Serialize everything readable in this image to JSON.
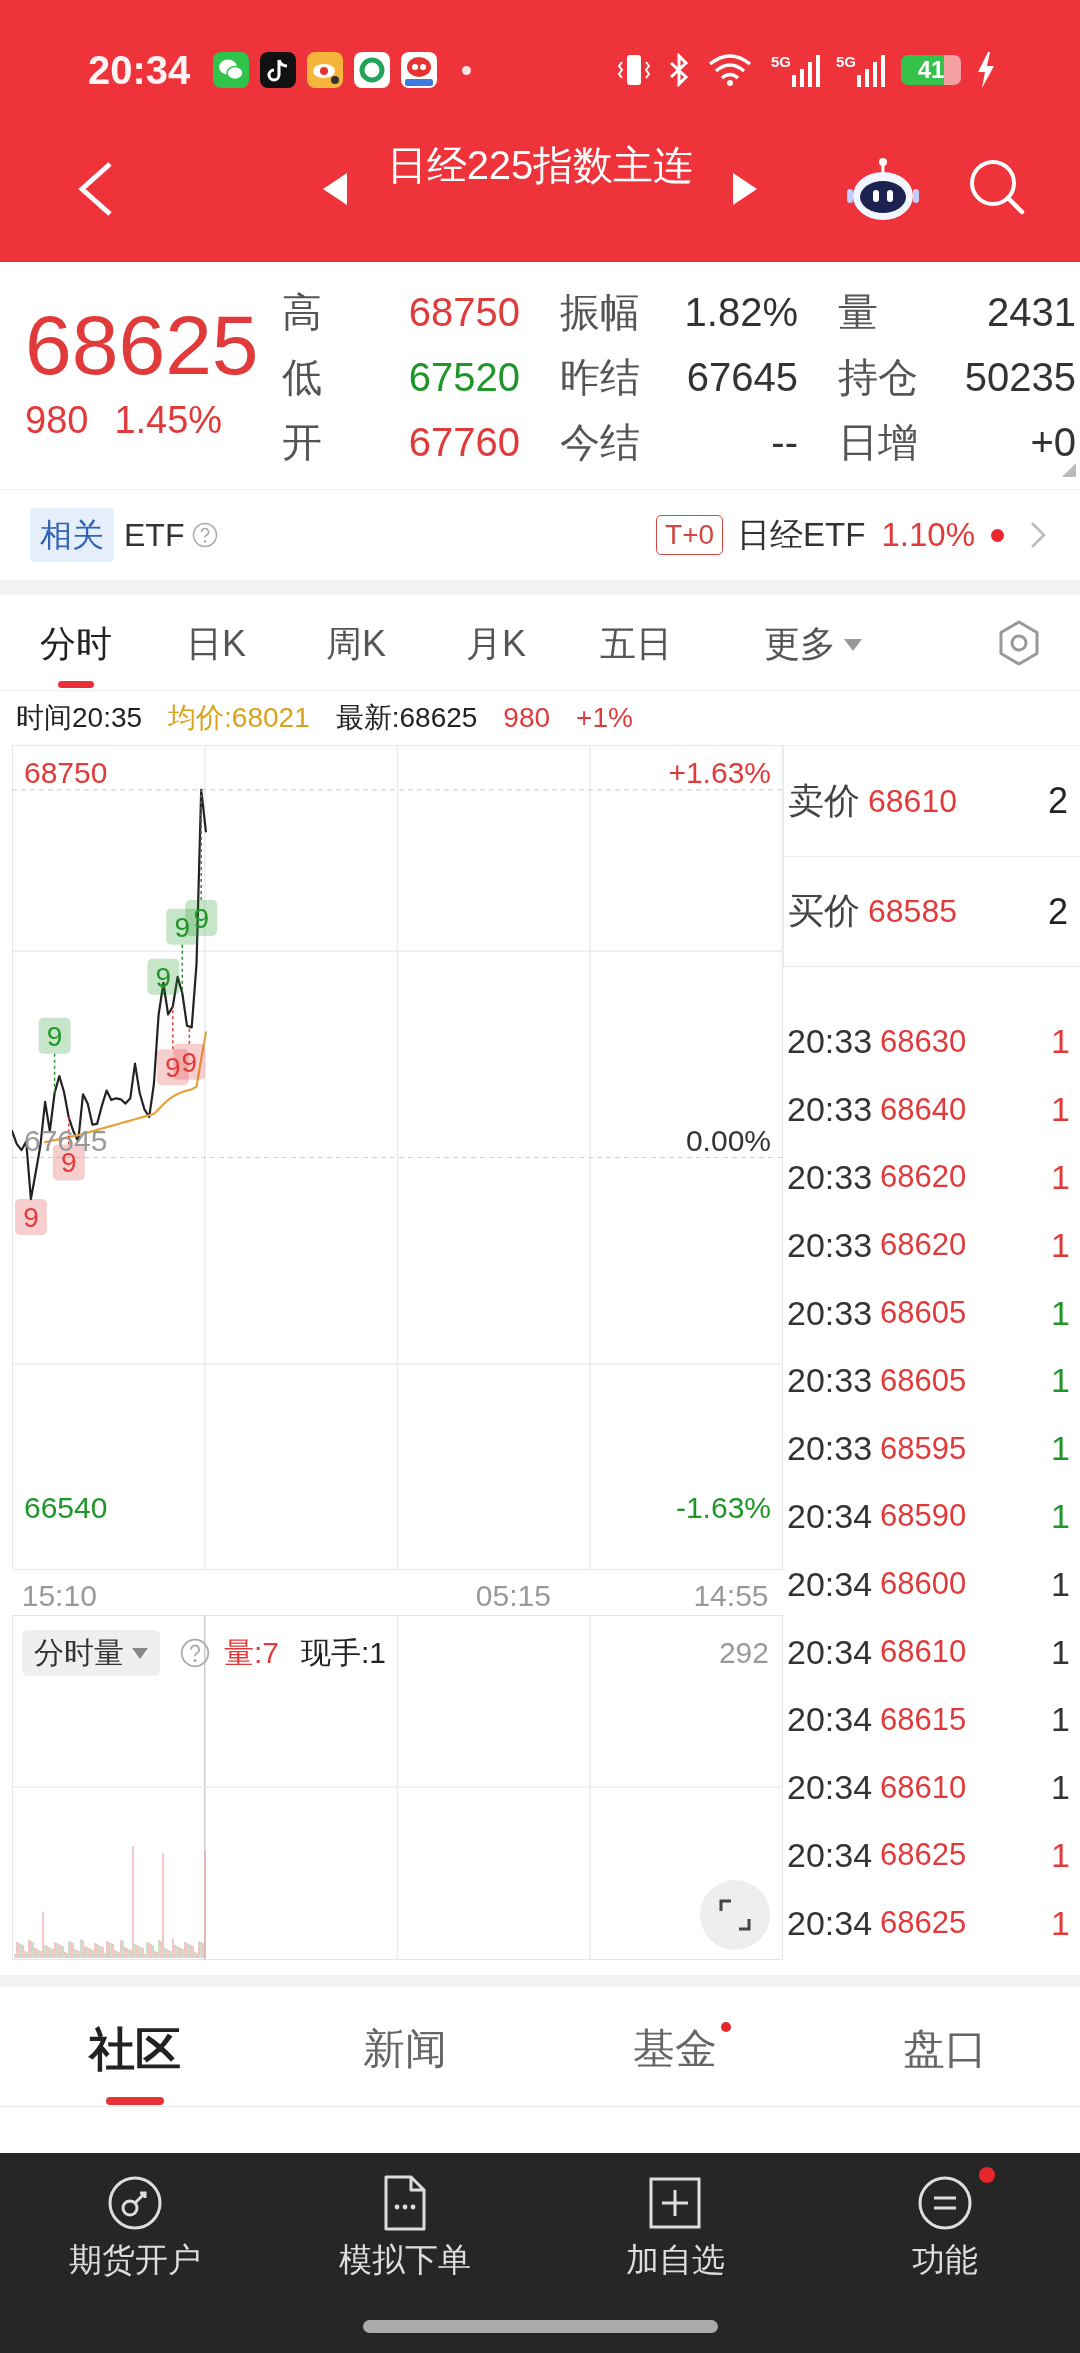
{
  "status_bar": {
    "time": "20:34",
    "network": [
      "5G",
      "5G"
    ],
    "battery": "41"
  },
  "header": {
    "title": "日经225指数主连"
  },
  "quote": {
    "price": "68625",
    "change": "980",
    "change_percent": "1.45%",
    "stats": [
      {
        "label": "高",
        "value": "68750",
        "color": "#e03a3a"
      },
      {
        "label": "振幅",
        "value": "1.82%",
        "color": "#333333"
      },
      {
        "label": "量",
        "value": "2431",
        "color": "#333333"
      },
      {
        "label": "低",
        "value": "67520",
        "color": "#1e9628"
      },
      {
        "label": "昨结",
        "value": "67645",
        "color": "#333333"
      },
      {
        "label": "持仓",
        "value": "50235",
        "color": "#333333"
      },
      {
        "label": "开",
        "value": "67760",
        "color": "#e03a3a"
      },
      {
        "label": "今结",
        "value": "--",
        "color": "#333333"
      },
      {
        "label": "日增",
        "value": "+0",
        "color": "#333333"
      }
    ]
  },
  "related": {
    "tag": "相关",
    "label": "ETF",
    "badge": "T+0",
    "fund": "日经ETF",
    "change": "1.10%"
  },
  "chart_tabs": [
    {
      "label": "分时",
      "selected": true,
      "kind": "tab"
    },
    {
      "label": "日K",
      "selected": false,
      "kind": "tab"
    },
    {
      "label": "周K",
      "selected": false,
      "kind": "tab"
    },
    {
      "label": "月K",
      "selected": false,
      "kind": "tab"
    },
    {
      "label": "五日",
      "selected": false,
      "kind": "tab"
    },
    {
      "label": "更多",
      "selected": false,
      "kind": "menu"
    }
  ],
  "info_line": [
    {
      "text": "时间20:35",
      "color": "#222222"
    },
    {
      "text": "均价:68021",
      "color": "#d9a21b"
    },
    {
      "text": "最新:68625",
      "color": "#222222"
    },
    {
      "text": "980",
      "color": "#e03a3a"
    },
    {
      "text": "+1%",
      "color": "#e03a3a"
    }
  ],
  "chart": {
    "change_labels": [
      {
        "text": "+1.63%",
        "color": "#e03a3a"
      },
      {
        "text": "0.00%",
        "color": "#333333"
      },
      {
        "text": "-1.63%",
        "color": "#1e9628"
      }
    ],
    "markers": [
      {
        "text": "9",
        "color": "#e03a3a"
      },
      {
        "text": "9",
        "color": "#1e9628"
      },
      {
        "text": "9",
        "color": "#e03a3a"
      },
      {
        "text": "9",
        "color": "#1e9628"
      },
      {
        "text": "9",
        "color": "#e03a3a"
      },
      {
        "text": "9",
        "color": "#1e9628"
      },
      {
        "text": "9",
        "color": "#e03a3a"
      },
      {
        "text": "9",
        "color": "#1e9628"
      }
    ],
    "chart_data": {
      "type": "line",
      "categories": [
        null,
        null,
        null,
        null,
        null,
        null,
        null,
        null,
        null,
        null,
        "15:10",
        null,
        null,
        null,
        null,
        null,
        null,
        null,
        null,
        null,
        null,
        null,
        null,
        null,
        null,
        null,
        null,
        null,
        null,
        null,
        null,
        null,
        null,
        null,
        null,
        null,
        null,
        null,
        null,
        null,
        null,
        null,
        null,
        null,
        null,
        null,
        null,
        null,
        null,
        null,
        null,
        null,
        null,
        null,
        null,
        null,
        null,
        null,
        null,
        null,
        null,
        null,
        null,
        null,
        null,
        null,
        null,
        null,
        null,
        null,
        null,
        null,
        null,
        null,
        null,
        null,
        null,
        null,
        null,
        null,
        null,
        null,
        null,
        null,
        null,
        null,
        null,
        null,
        null,
        null,
        null,
        null,
        null,
        null,
        null,
        null,
        null,
        null,
        null,
        null,
        null,
        null,
        null,
        null,
        null,
        null,
        "05:15",
        null,
        null,
        null,
        null,
        null,
        null,
        null,
        null,
        null,
        null,
        null,
        null,
        null,
        null,
        null,
        null,
        null,
        null,
        null,
        null,
        null,
        null,
        null,
        null,
        null,
        null,
        null,
        null,
        null,
        null,
        null,
        null,
        null,
        null,
        null,
        null,
        null,
        null,
        null,
        null,
        null,
        null,
        null,
        null,
        null,
        "14:55",
        null,
        null,
        null,
        null,
        null,
        null,
        null,
        null,
        null,
        null,
        null
      ],
      "series": [
        {
          "color": "#222222",
          "values": [
            67725,
            67686,
            67667,
            67693,
            67520,
            67600,
            67681,
            67812,
            67724,
            67839,
            67890,
            67842,
            67765,
            67723,
            67694,
            67835,
            67807,
            67744,
            67746,
            67801,
            67846,
            67818,
            67823,
            67820,
            67807,
            67823,
            67927,
            67839,
            67790,
            67767,
            67866,
            68074,
            68170,
            68075,
            68099,
            68188,
            68139,
            68041,
            68036,
            68226,
            68750,
            68625,
            null,
            null,
            null,
            null,
            null,
            null,
            null,
            null,
            null,
            null,
            null,
            null,
            null,
            null,
            null,
            null,
            null,
            null,
            null,
            null,
            null,
            null,
            null,
            null,
            null,
            null,
            null,
            null,
            null,
            null,
            null,
            null,
            null,
            null,
            null,
            null,
            null,
            null,
            null,
            null,
            null,
            null,
            null,
            null,
            null,
            null,
            null,
            null,
            null,
            null,
            null,
            null,
            null,
            null,
            null,
            null,
            null,
            null,
            null,
            null,
            null,
            null,
            null,
            null,
            null,
            null,
            null,
            null,
            null,
            null,
            null,
            null,
            null,
            null,
            null,
            null,
            null,
            null,
            null,
            null,
            null,
            null,
            null,
            null,
            null,
            null,
            null,
            null,
            null,
            null,
            null,
            null,
            null,
            null,
            null,
            null,
            null,
            null,
            null,
            null,
            null,
            null,
            null,
            null,
            null,
            null,
            null,
            null,
            null,
            null,
            null,
            null,
            null,
            null,
            null,
            null,
            null,
            null,
            null,
            null,
            null,
            null
          ]
        },
        {
          "color": "#e6a23c",
          "values": [
            null,
            null,
            null,
            null,
            null,
            null,
            null,
            67691,
            67694,
            67697,
            67700,
            67703,
            67706,
            67709,
            67712,
            67716,
            67720,
            67724,
            67728,
            67732,
            67736,
            67740,
            67744,
            67748,
            67752,
            67756,
            67760,
            67764,
            67768,
            67772,
            67776,
            67790,
            67805,
            67818,
            67828,
            67836,
            67842,
            67846,
            67850,
            67858,
            67940,
            68021,
            null,
            null,
            null,
            null,
            null,
            null,
            null,
            null,
            null,
            null,
            null,
            null,
            null,
            null,
            null,
            null,
            null,
            null,
            null,
            null,
            null,
            null,
            null,
            null,
            null,
            null,
            null,
            null,
            null,
            null,
            null,
            null,
            null,
            null,
            null,
            null,
            null,
            null,
            null,
            null,
            null,
            null,
            null,
            null,
            null,
            null,
            null,
            null,
            null,
            null,
            null,
            null,
            null,
            null,
            null,
            null,
            null,
            null,
            null,
            null,
            null,
            null,
            null,
            null,
            null,
            null,
            null,
            null,
            null,
            null,
            null,
            null,
            null,
            null,
            null,
            null,
            null,
            null,
            null,
            null,
            null,
            null,
            null,
            null,
            null,
            null,
            null,
            null,
            null,
            null,
            null,
            null,
            null,
            null,
            null,
            null,
            null,
            null,
            null,
            null,
            null,
            null,
            null,
            null,
            null,
            null,
            null,
            null,
            null,
            null,
            null,
            null,
            null,
            null,
            null,
            null,
            null,
            null,
            null,
            null,
            null,
            null
          ]
        }
      ],
      "ylim": [
        66405,
        68885
      ],
      "yticks": [
        {
          "value": 68750,
          "label": "68750"
        },
        {
          "value": 67645,
          "label": "67645"
        },
        {
          "value": 66540,
          "label": "66540"
        }
      ]
    }
  },
  "volume": {
    "selector": "分时量",
    "volume": "量:7",
    "current": "现手:1",
    "max": "292"
  },
  "ticks": {
    "quotes": [
      {
        "label": "卖价",
        "price": "68610",
        "volume": "2"
      },
      {
        "label": "买价",
        "price": "68585",
        "volume": "2"
      }
    ],
    "rows": [
      {
        "time": "20:33",
        "price": "68630",
        "volume": "1",
        "color": "#e03a3a"
      },
      {
        "time": "20:33",
        "price": "68640",
        "volume": "1",
        "color": "#e03a3a"
      },
      {
        "time": "20:33",
        "price": "68620",
        "volume": "1",
        "color": "#e03a3a"
      },
      {
        "time": "20:33",
        "price": "68620",
        "volume": "1",
        "color": "#e03a3a"
      },
      {
        "time": "20:33",
        "price": "68605",
        "volume": "1",
        "color": "#1e9628"
      },
      {
        "time": "20:33",
        "price": "68605",
        "volume": "1",
        "color": "#1e9628"
      },
      {
        "time": "20:33",
        "price": "68595",
        "volume": "1",
        "color": "#1e9628"
      },
      {
        "time": "20:34",
        "price": "68590",
        "volume": "1",
        "color": "#1e9628"
      },
      {
        "time": "20:34",
        "price": "68600",
        "volume": "1",
        "color": "#333333"
      },
      {
        "time": "20:34",
        "price": "68610",
        "volume": "1",
        "color": "#333333"
      },
      {
        "time": "20:34",
        "price": "68615",
        "volume": "1",
        "color": "#333333"
      },
      {
        "time": "20:34",
        "price": "68610",
        "volume": "1",
        "color": "#333333"
      },
      {
        "time": "20:34",
        "price": "68625",
        "volume": "1",
        "color": "#e03a3a"
      },
      {
        "time": "20:34",
        "price": "68625",
        "volume": "1",
        "color": "#e03a3a"
      }
    ]
  },
  "content_tabs": [
    {
      "label": "社区",
      "selected": true,
      "dot": false
    },
    {
      "label": "新闻",
      "selected": false,
      "dot": false
    },
    {
      "label": "基金",
      "selected": false,
      "dot": true
    },
    {
      "label": "盘口",
      "selected": false,
      "dot": false
    }
  ],
  "toolbar": [
    {
      "label": "期货开户",
      "kind": "account",
      "dot": false
    },
    {
      "label": "模拟下单",
      "kind": "order",
      "dot": false
    },
    {
      "label": "加自选",
      "kind": "add",
      "dot": false
    },
    {
      "label": "功能",
      "kind": "functions",
      "dot": true
    }
  ]
}
